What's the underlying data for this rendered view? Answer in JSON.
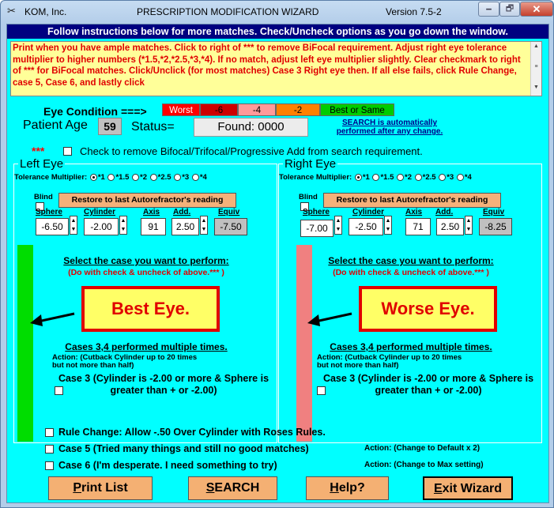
{
  "titlebar": {
    "app_name": "KOM, Inc.",
    "title": "PRESCRIPTION MODIFICATION WIZARD",
    "version": "Version 7.5-2",
    "minimize": "🗕",
    "maximize": "🗗",
    "close": "✕"
  },
  "header": "Follow instructions below for more matches. Check/Uncheck options as you go down the window.",
  "instructions": "Print when you have ample matches. Click to right of *** to remove BiFocal requirement. Adjust right eye tolerance multiplier to higher numbers (*1.5,*2,*2.5,*3,*4). If no match, adjust left eye multiplier slightly. Clear checkmark to right of *** for BiFocal matches. Click/Unclick (for most matches) Case 3 Right eye then. If all else fails, click Rule Change, case 5, Case 6, and  lastly click",
  "eye_condition": {
    "label": "Eye Condition ===>",
    "levels": [
      {
        "label": "Worst",
        "color": "#ff0000",
        "text_color": "#ffffff"
      },
      {
        "label": "-6",
        "color": "#cc0000",
        "text_color": "#000000"
      },
      {
        "label": "-4",
        "color": "#ff9999",
        "text_color": "#000000"
      },
      {
        "label": "-2",
        "color": "#ff8000",
        "text_color": "#000000"
      },
      {
        "label": "Best or Same",
        "color": "#00cc00",
        "text_color": "#000000"
      }
    ]
  },
  "patient": {
    "age_label": "Patient Age",
    "age": "59",
    "status_label": "Status=",
    "status": "Found:  0000"
  },
  "search_note": "SEARCH is automatically performed after any change.",
  "bifocal": {
    "stars": "***",
    "label": "Check to remove Bifocal/Trifocal/Progressive Add from search requirement."
  },
  "tolerance_label": "Tolerance Multiplier:",
  "tolerance_options": [
    "*1",
    "*1.5",
    "*2",
    "*2.5",
    "*3",
    "*4"
  ],
  "columns": {
    "sphere": "Sphere",
    "cylinder": "Cylinder",
    "axis": "Axis",
    "add": "Add.",
    "equiv": "Equiv"
  },
  "blind_label": "Blind",
  "restore_label": "Restore to last Autorefractor's reading",
  "select_case": "Select the case you want to perform:",
  "select_case_sub": "(Do with check & uncheck of above.*** )",
  "cases_title": "Cases 3,4 performed multiple times.",
  "cases_action": "Action:  (Cutback Cylinder up to 20 times but not more than half)",
  "case3_label": "Case 3 (Cylinder is -2.00 or more & Sphere is greater than + or -2.00)",
  "left_eye": {
    "title": "Left Eye",
    "sphere": "-6.50",
    "cylinder": "-2.00",
    "axis": "91",
    "add": "2.50",
    "equiv": "-7.50",
    "bar_color": "#00dd00",
    "callout": "Best Eye."
  },
  "right_eye": {
    "title": "Right Eye",
    "sphere": "-7.00",
    "cylinder": "-2.50",
    "axis": "71",
    "add": "2.50",
    "equiv": "-8.25",
    "bar_color": "#f08080",
    "callout": "Worse Eye."
  },
  "rule_change": "Rule Change: Allow -.50 Over Cylinder with Roses Rules.",
  "case5": {
    "label": "Case 5 (Tried many things and still no good matches)",
    "action": "Action:  (Change to Default x 2)"
  },
  "case6": {
    "label": "Case 6 (I'm desperate.  I need something to try)",
    "action": "Action:  (Change to Max setting)"
  },
  "buttons": {
    "print_pre": "",
    "print_u": "P",
    "print_post": "rint List",
    "search_u": "S",
    "search_post": "EARCH",
    "help_u": "H",
    "help_post": "elp?",
    "exit_u": "E",
    "exit_post": "xit Wizard"
  }
}
